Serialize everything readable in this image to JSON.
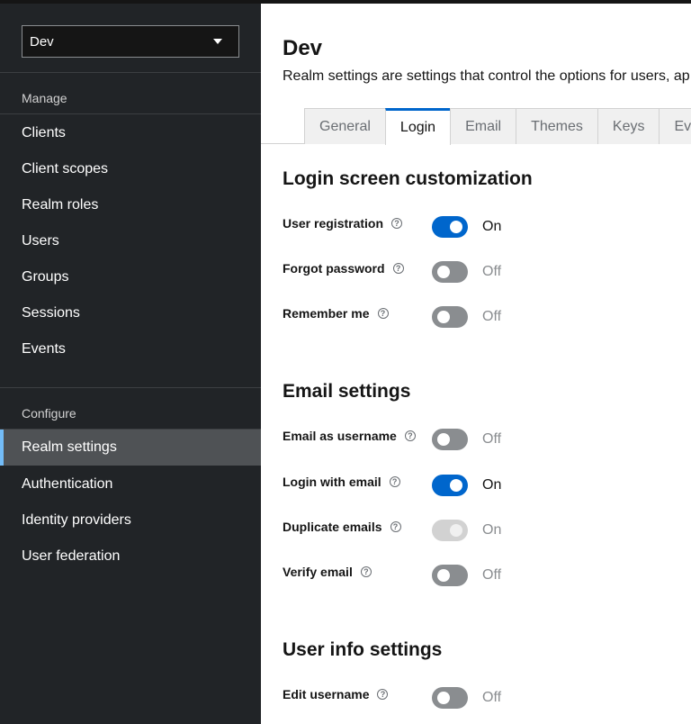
{
  "sidebar": {
    "realm_selector": {
      "value": "Dev"
    },
    "manage_heading": "Manage",
    "manage_items": [
      "Clients",
      "Client scopes",
      "Realm roles",
      "Users",
      "Groups",
      "Sessions",
      "Events"
    ],
    "configure_heading": "Configure",
    "configure_items": [
      "Realm settings",
      "Authentication",
      "Identity providers",
      "User federation"
    ],
    "active_item": "Realm settings"
  },
  "header": {
    "title": "Dev",
    "description": "Realm settings are settings that control the options for users, ap"
  },
  "tabs": [
    "General",
    "Login",
    "Email",
    "Themes",
    "Keys",
    "Eve"
  ],
  "active_tab": "Login",
  "sections": [
    {
      "title": "Login screen customization",
      "rows": [
        {
          "label": "User registration",
          "state": "On"
        },
        {
          "label": "Forgot password",
          "state": "Off"
        },
        {
          "label": "Remember me",
          "state": "Off"
        }
      ]
    },
    {
      "title": "Email settings",
      "rows": [
        {
          "label": "Email as username",
          "state": "Off"
        },
        {
          "label": "Login with email",
          "state": "On"
        },
        {
          "label": "Duplicate emails",
          "state": "On",
          "disabled": true
        },
        {
          "label": "Verify email",
          "state": "Off"
        }
      ]
    },
    {
      "title": "User info settings",
      "rows": [
        {
          "label": "Edit username",
          "state": "Off"
        }
      ]
    }
  ],
  "help_icon_glyph": "?",
  "colors": {
    "accent": "#0066cc",
    "sidebar_bg": "#212427",
    "active_nav_bg": "#4f5255",
    "active_indicator": "#73bcf7"
  }
}
